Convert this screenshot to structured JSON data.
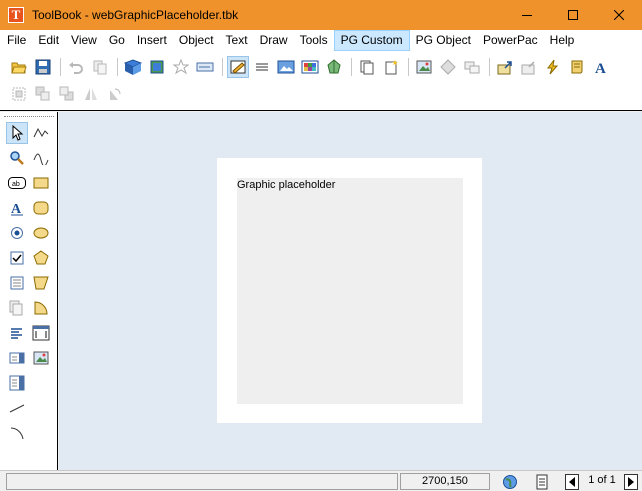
{
  "window": {
    "title": "ToolBook - webGraphicPlaceholder.tbk",
    "app_icon_letter": "T"
  },
  "menu": {
    "items": [
      {
        "label": "File",
        "active": false
      },
      {
        "label": "Edit",
        "active": false
      },
      {
        "label": "View",
        "active": false
      },
      {
        "label": "Go",
        "active": false
      },
      {
        "label": "Insert",
        "active": false
      },
      {
        "label": "Object",
        "active": false
      },
      {
        "label": "Text",
        "active": false
      },
      {
        "label": "Draw",
        "active": false
      },
      {
        "label": "Tools",
        "active": false
      },
      {
        "label": "PG Custom",
        "active": true
      },
      {
        "label": "PG Object",
        "active": false
      },
      {
        "label": "PowerPac",
        "active": false
      },
      {
        "label": "Help",
        "active": false
      }
    ]
  },
  "toolbar": {
    "pressed_tool": "draw-tool-icon"
  },
  "palette": {
    "pressed_tool": "pointer-tool-icon"
  },
  "canvas": {
    "placeholder_label": "Graphic placeholder"
  },
  "status": {
    "coords": "2700,150",
    "page_info": "1 of 1"
  },
  "colors": {
    "titlebar": "#f0922b",
    "workspace": "#e1eaf2",
    "placeholder": "#efefef",
    "menu_active": "#cce8ff"
  }
}
